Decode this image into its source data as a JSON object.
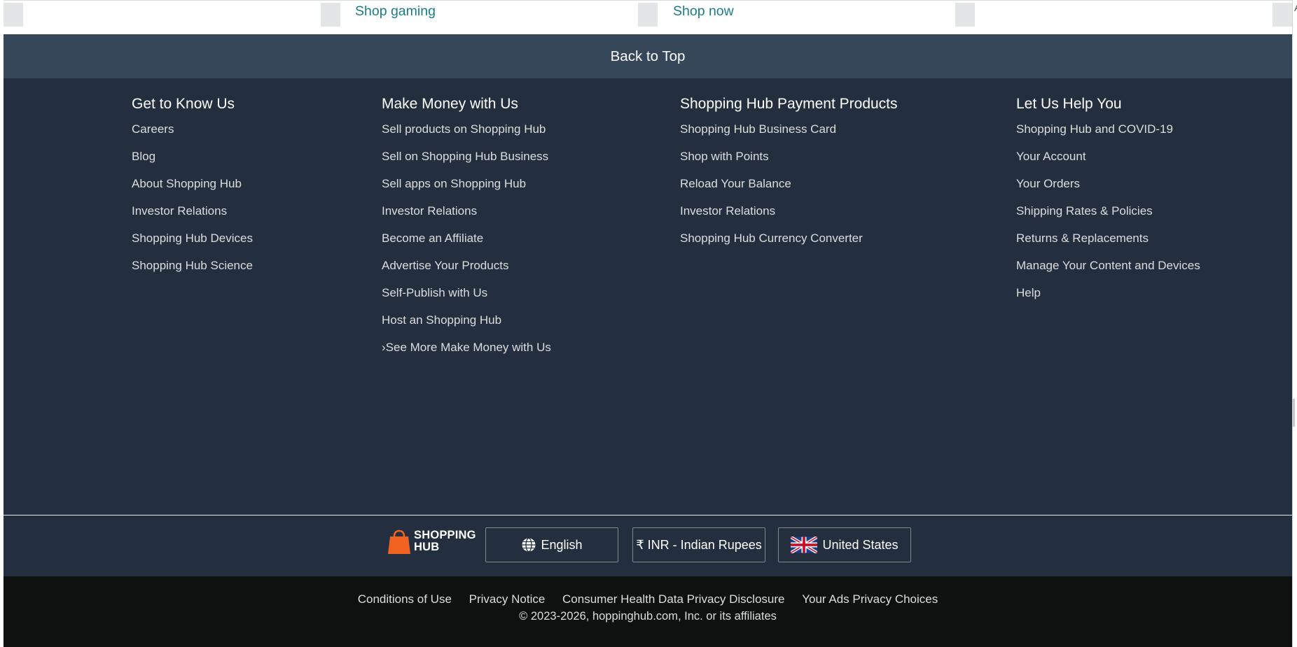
{
  "carousel": {
    "links": [
      "Shop gaming",
      "Shop now"
    ],
    "edge_char": "A"
  },
  "back_to_top": "Back to Top",
  "columns": [
    {
      "heading": "Get to Know Us",
      "items": [
        "Careers",
        "Blog",
        "About Shopping Hub",
        "Investor Relations",
        "Shopping Hub Devices",
        "Shopping Hub Science"
      ]
    },
    {
      "heading": "Make Money with Us",
      "items": [
        "Sell products on Shopping Hub",
        "Sell on Shopping Hub Business",
        "Sell apps on Shopping Hub",
        "Investor Relations",
        "Become an Affiliate",
        "Advertise Your Products",
        "Self-Publish with Us",
        "Host an Shopping Hub",
        "›See More Make Money with Us"
      ]
    },
    {
      "heading": "Shopping Hub Payment Products",
      "items": [
        "Shopping Hub Business Card",
        "Shop with Points",
        "Reload Your Balance",
        "Investor Relations",
        "Shopping Hub Currency Converter"
      ]
    },
    {
      "heading": "Let Us Help You",
      "items": [
        "Shopping Hub and COVID-19",
        "Your Account",
        "Your Orders",
        "Shipping Rates & Policies",
        "Returns & Replacements",
        "Manage Your Content and Devices",
        "Help"
      ]
    }
  ],
  "logo": {
    "line1": "SHOPPING",
    "line2": "HUB",
    "color": "#f0621f"
  },
  "locale": {
    "language": "English",
    "currency": "₹ INR - Indian Rupees",
    "country": "United States"
  },
  "legal": {
    "links": [
      "Conditions of Use",
      "Privacy Notice",
      "Consumer Health Data Privacy Disclosure",
      "Your Ads Privacy Choices"
    ],
    "copyright": "© 2023-2026, hoppinghub.com, Inc. or its affiliates"
  },
  "colors": {
    "back_to_top_bg": "#37475a",
    "footer_bg": "#232f3e",
    "legal_bg": "#0f1111",
    "link_teal": "#1b7b88"
  }
}
